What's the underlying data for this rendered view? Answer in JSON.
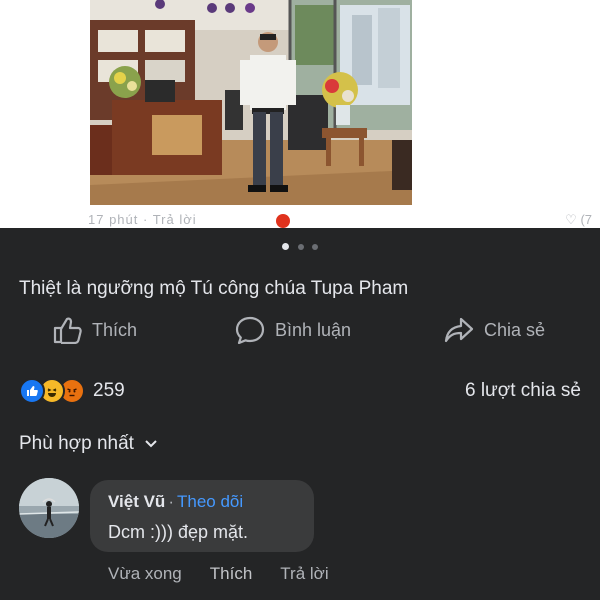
{
  "post": {
    "caption": "Thiệt là ngưỡng mộ Tú công chúa Tupa Pham",
    "peek_meta": "17 phút · Trả lời",
    "peek_right": "♡ (7"
  },
  "actions": {
    "like_label": "Thích",
    "comment_label": "Bình luận",
    "share_label": "Chia sẻ"
  },
  "stats": {
    "reaction_icons": [
      "like-icon",
      "haha-icon",
      "angry-icon"
    ],
    "reaction_count": "259",
    "shares_text": "6 lượt chia sẻ"
  },
  "sort": {
    "label": "Phù hợp nhất"
  },
  "comment": {
    "author": "Việt Vũ",
    "separator": "·",
    "follow_label": "Theo dõi",
    "text": "Dcm :))) đẹp mặt.",
    "time": "Vừa xong",
    "like_label": "Thích",
    "reply_label": "Trả lời"
  },
  "colors": {
    "dark_bg": "#242526",
    "bubble_bg": "#3a3b3c",
    "follow_link": "#4599ff",
    "primary_text": "#e4e6eb",
    "secondary_text": "#b0b3b8"
  },
  "carousel": {
    "pages": 3,
    "active_index": 0
  }
}
